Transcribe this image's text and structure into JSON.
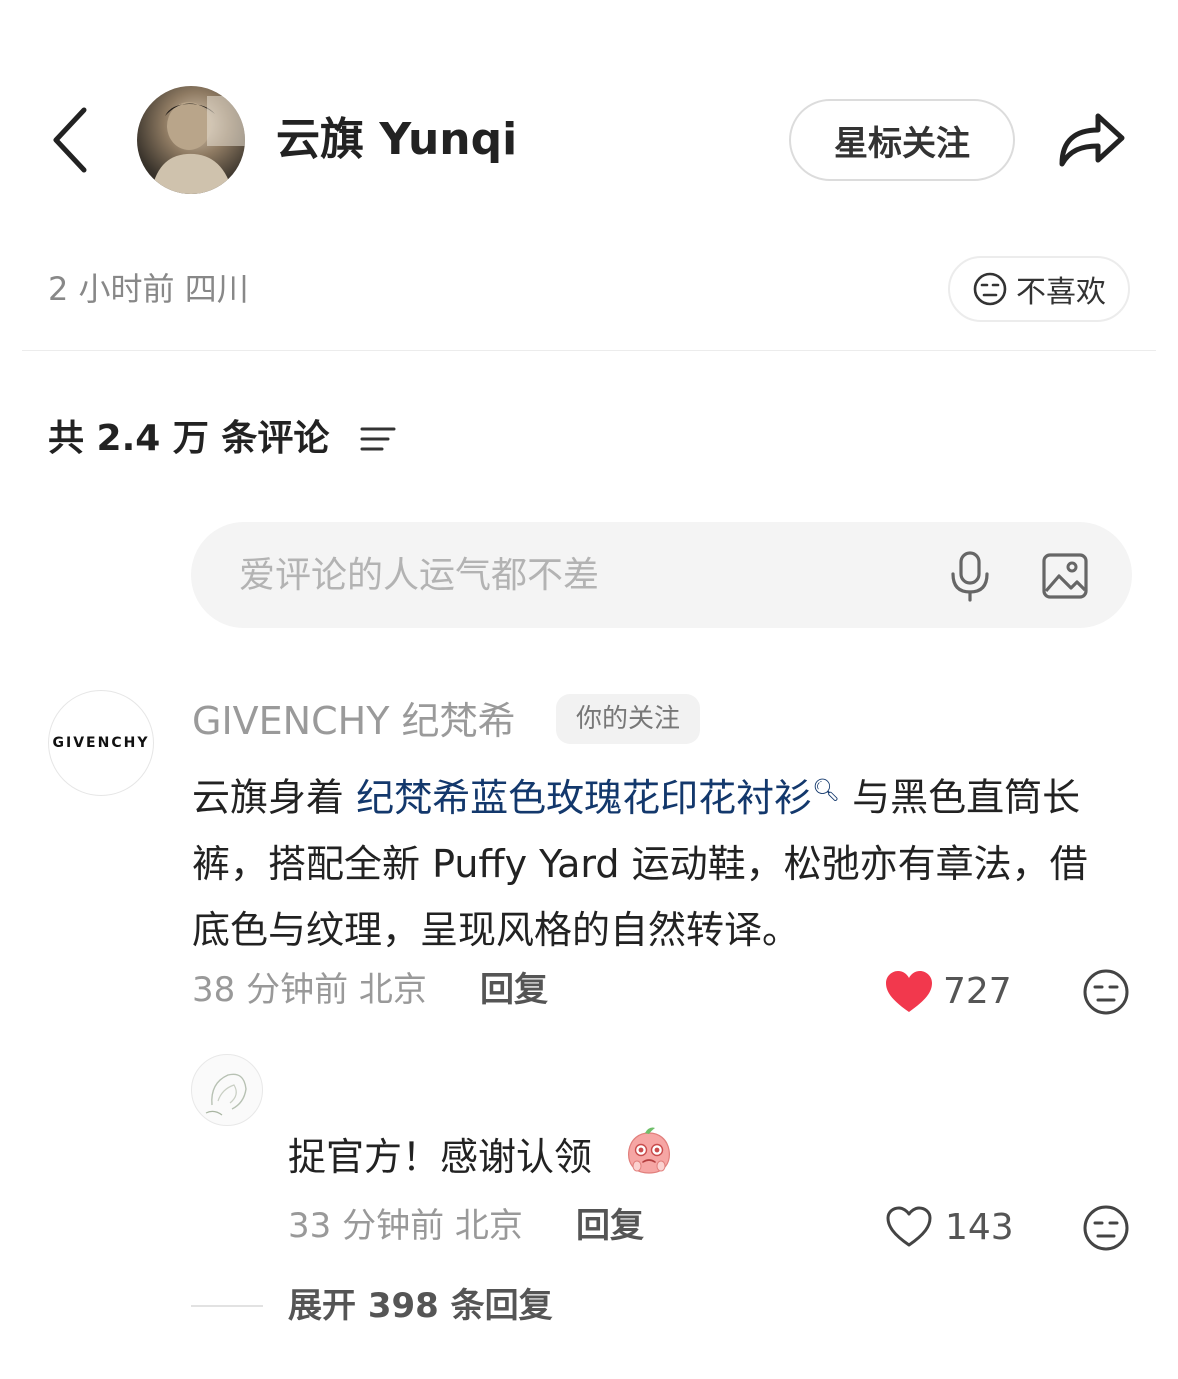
{
  "header": {
    "author_name": "云旗 Yunqi",
    "star_follow_label": "星标关注"
  },
  "post": {
    "meta": "2 小时前 四川",
    "dislike_label": "不喜欢"
  },
  "comments_section": {
    "count_label": "共 2.4 万 条评论",
    "input_placeholder": "爱评论的人运气都不差"
  },
  "comments": [
    {
      "author": "GIVENCHY 纪梵希",
      "avatar_text": "GIVENCHY",
      "badge": "你的关注",
      "text_before_link": "云旗身着 ",
      "link_text": "纪梵希蓝色玫瑰花印花衬衫",
      "text_after_link": " 与黑色直筒长裤，搭配全新 Puffy Yard 运动鞋，松弛亦有章法，借底色与纹理，呈现风格的自然转译。",
      "meta": "38 分钟前 北京",
      "reply_label": "回复",
      "likes": "727",
      "liked": true,
      "like_color": "#f2384d"
    }
  ],
  "replies": [
    {
      "text": "捉官方！感谢认领",
      "meta": "33 分钟前 北京",
      "reply_label": "回复",
      "likes": "143",
      "liked": false
    }
  ],
  "expand_replies_label": "展开 398 条回复"
}
